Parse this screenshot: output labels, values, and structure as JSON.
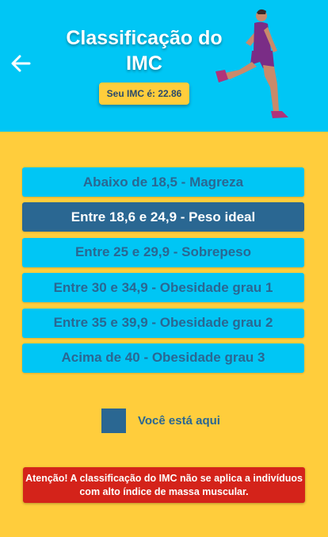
{
  "header": {
    "title": "Classificação do IMC",
    "imc_badge": "Seu IMC é: 22.86",
    "back_icon": "arrow-left-icon",
    "illustration": "runner-illustration"
  },
  "classifications": [
    {
      "label": "Abaixo de 18,5 - Magreza",
      "active": false
    },
    {
      "label": "Entre 18,6 e 24,9 - Peso ideal",
      "active": true
    },
    {
      "label": "Entre 25 e 29,9 - Sobrepeso",
      "active": false
    },
    {
      "label": "Entre 30 e 34,9 - Obesidade grau 1",
      "active": false
    },
    {
      "label": "Entre 35 e 39,9 - Obesidade grau 2",
      "active": false
    },
    {
      "label": "Acima de 40 - Obesidade grau 3",
      "active": false
    }
  ],
  "legend": {
    "label": "Você está aqui"
  },
  "warning": {
    "text": "Atenção! A classificação do IMC não se aplica a indivíduos com alto índice de massa muscular."
  },
  "colors": {
    "header_bg": "#00c6f5",
    "page_bg": "#ffcd3c",
    "item_bg": "#00c6f5",
    "active_bg": "#2a6792",
    "warning_bg": "#d4231a"
  }
}
